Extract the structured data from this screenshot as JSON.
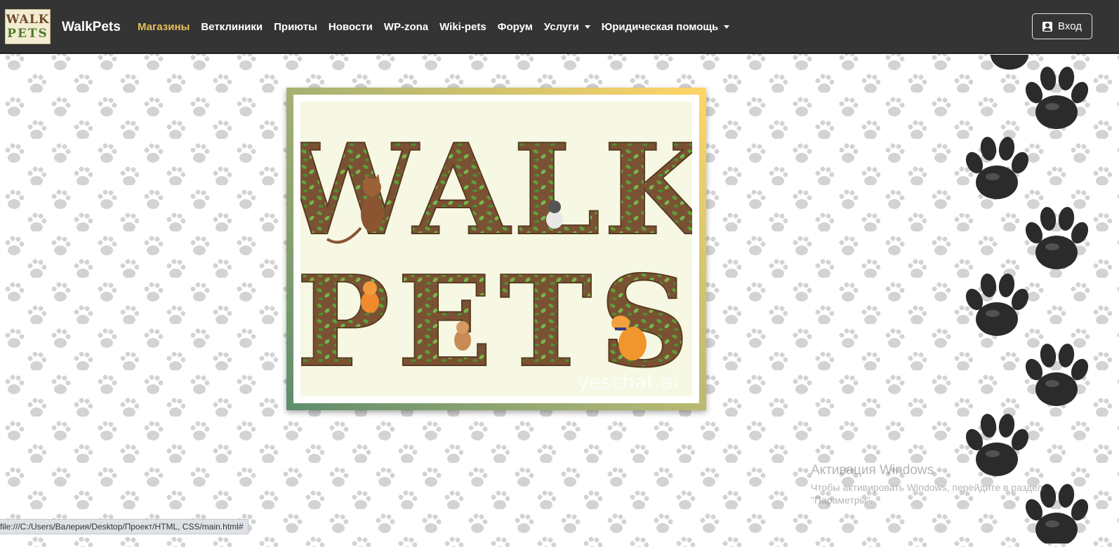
{
  "logo": {
    "line1": "WALK",
    "line2": "PETS"
  },
  "brand": "WalkPets",
  "nav": [
    {
      "label": "Магазины",
      "active": true
    },
    {
      "label": "Ветклиники"
    },
    {
      "label": "Приюты"
    },
    {
      "label": "Новости"
    },
    {
      "label": "WP-zona"
    },
    {
      "label": "Wiki-pets"
    },
    {
      "label": "Форум"
    },
    {
      "label": "Услуги",
      "dropdown": true
    },
    {
      "label": "Юридическая помощь",
      "dropdown": true
    }
  ],
  "login": {
    "label": "Вход",
    "icon": "user-icon"
  },
  "hero": {
    "line1": "WALK",
    "line2": "PETS",
    "watermark": "yeschat.ai"
  },
  "windows_activation": {
    "title": "Активация Windows",
    "text": "Чтобы активировать Windows, перейдите в раздел \"Параметры\"."
  },
  "status_bar": "file:///C:/Users/Валерия/Desktop/Проект/HTML, CSS/main.html#",
  "colors": {
    "nav_bg": "#343434",
    "active_link": "#e8c05b",
    "poster_bg": "#f6f8e3",
    "paw": "#2b2b2b"
  }
}
